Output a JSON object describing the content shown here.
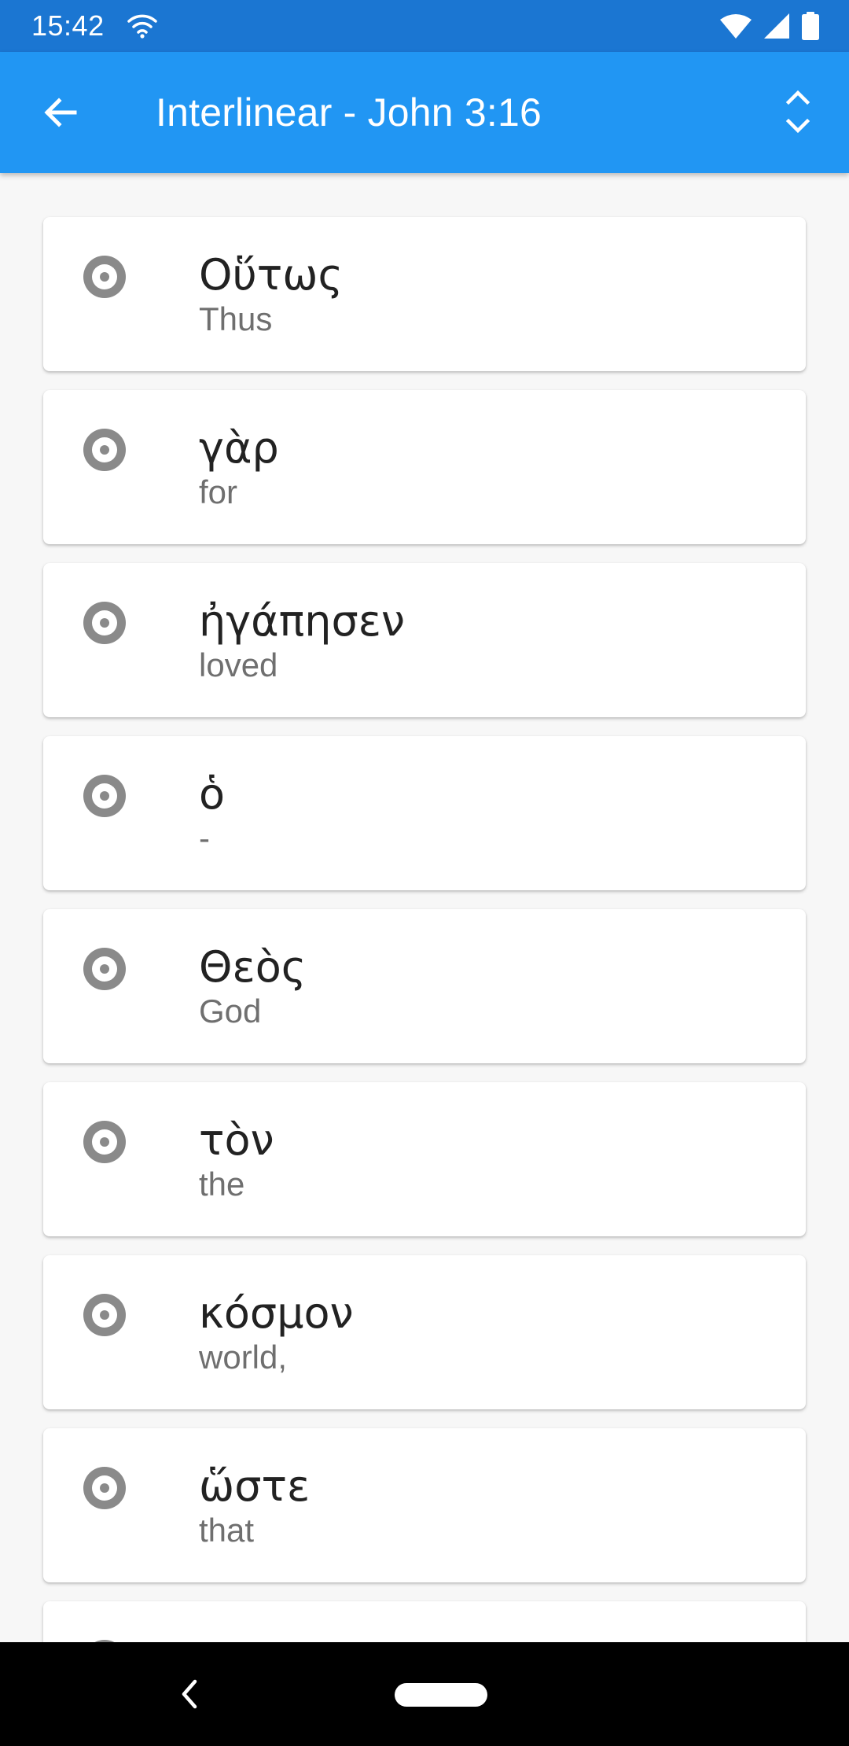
{
  "status_bar": {
    "time": "15:42"
  },
  "app_bar": {
    "title": "Interlinear - John 3:16"
  },
  "words": [
    {
      "greek": "Οὕτως",
      "gloss": "Thus"
    },
    {
      "greek": "γὰρ",
      "gloss": "for"
    },
    {
      "greek": "ἠγάπησεν",
      "gloss": "loved"
    },
    {
      "greek": "ὁ",
      "gloss": "-"
    },
    {
      "greek": "Θεὸς",
      "gloss": "God"
    },
    {
      "greek": "τὸν",
      "gloss": "the"
    },
    {
      "greek": "κόσμον",
      "gloss": "world,"
    },
    {
      "greek": "ὥστε",
      "gloss": "that"
    },
    {
      "greek": "",
      "gloss": ""
    }
  ],
  "colors": {
    "status_bar": "#1b76d2",
    "app_bar": "#2196f3",
    "play_icon": "#8a8a8a"
  }
}
